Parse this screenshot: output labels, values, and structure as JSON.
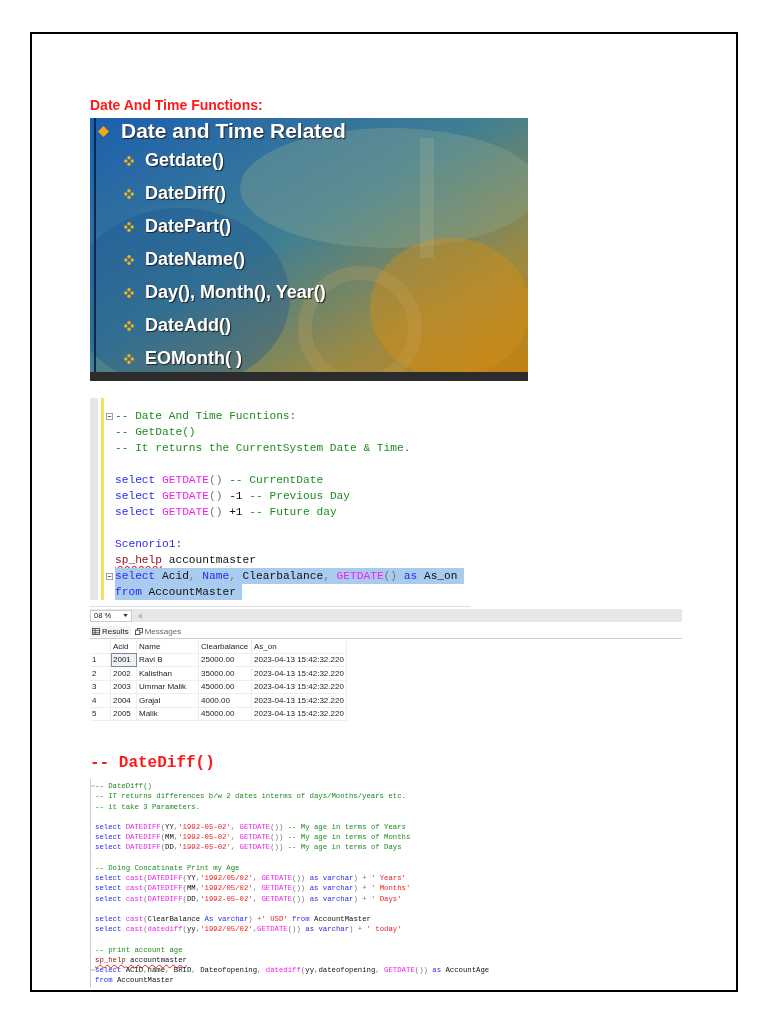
{
  "page_heading": "Date And Time Functions:",
  "slide": {
    "title": "Date and Time Related",
    "items": [
      "Getdate()",
      "DateDiff()",
      "DatePart()",
      "DateName()",
      "Day(), Month(), Year()",
      "DateAdd()",
      "EOMonth( )"
    ]
  },
  "editor": {
    "blocks": [
      [
        {
          "fold": true,
          "selected": false,
          "tokens": [
            {
              "kind": "comment",
              "text": "-- Date And Time Fucntions:"
            }
          ]
        },
        {
          "fold": false,
          "selected": false,
          "tokens": [
            {
              "kind": "comment",
              "text": "-- GetDate()"
            }
          ]
        },
        {
          "fold": false,
          "selected": false,
          "tokens": [
            {
              "kind": "comment",
              "text": "-- It returns the CurrentSystem Date & Time."
            }
          ]
        }
      ],
      [
        {
          "fold": false,
          "selected": false,
          "tokens": [
            {
              "kind": "keyword",
              "text": "select "
            },
            {
              "kind": "function",
              "text": "GETDATE"
            },
            {
              "kind": "operator",
              "text": "() "
            },
            {
              "kind": "comment",
              "text": "-- CurrentDate"
            }
          ]
        },
        {
          "fold": false,
          "selected": false,
          "tokens": [
            {
              "kind": "keyword",
              "text": "select "
            },
            {
              "kind": "function",
              "text": "GETDATE"
            },
            {
              "kind": "operator",
              "text": "() "
            },
            {
              "kind": "plain",
              "text": "-1 "
            },
            {
              "kind": "comment",
              "text": "-- Previous Day"
            }
          ]
        },
        {
          "fold": false,
          "selected": false,
          "tokens": [
            {
              "kind": "keyword",
              "text": "select "
            },
            {
              "kind": "function",
              "text": "GETDATE"
            },
            {
              "kind": "operator",
              "text": "() "
            },
            {
              "kind": "plain",
              "text": "+1 "
            },
            {
              "kind": "comment",
              "text": "-- Future day"
            }
          ]
        }
      ],
      [
        {
          "fold": false,
          "selected": false,
          "tokens": [
            {
              "kind": "keyword",
              "text": "Scenorio1:"
            }
          ]
        },
        {
          "fold": false,
          "selected": false,
          "tokens": [
            {
              "kind": "procedure",
              "text": "sp_help"
            },
            {
              "kind": "plain",
              "text": " accountmaster"
            }
          ]
        },
        {
          "fold": true,
          "selected": true,
          "tokens": [
            {
              "kind": "keyword",
              "text": "select "
            },
            {
              "kind": "plain",
              "text": "Acid"
            },
            {
              "kind": "operator",
              "text": ", "
            },
            {
              "kind": "keyword",
              "text": "Name"
            },
            {
              "kind": "operator",
              "text": ", "
            },
            {
              "kind": "plain",
              "text": "Clearbalance"
            },
            {
              "kind": "operator",
              "text": ", "
            },
            {
              "kind": "function",
              "text": "GETDATE"
            },
            {
              "kind": "operator",
              "text": "() "
            },
            {
              "kind": "keyword",
              "text": "as "
            },
            {
              "kind": "plain",
              "text": "As_on"
            }
          ]
        },
        {
          "fold": false,
          "selected": true,
          "tokens": [
            {
              "kind": "keyword",
              "text": "from "
            },
            {
              "kind": "plain",
              "text": "AccountMaster"
            }
          ]
        }
      ]
    ]
  },
  "results": {
    "zoom": "08 %",
    "tabs": [
      {
        "kind": "grid",
        "label": "Results",
        "selected": true
      },
      {
        "kind": "messages",
        "label": "Messages",
        "selected": false
      }
    ],
    "columns": [
      "Acid",
      "Name",
      "Clearbalance",
      "As_on"
    ],
    "rows": [
      {
        "number": "1",
        "cells": [
          {
            "text": "2001",
            "selected": true
          },
          {
            "text": "Ravi B",
            "selected": false
          },
          {
            "text": "25000.00",
            "selected": false
          },
          {
            "text": "2023-04-13 15:42:32.220",
            "selected": false
          }
        ]
      },
      {
        "number": "2",
        "cells": [
          {
            "text": "2002",
            "selected": false
          },
          {
            "text": "Kalisthan",
            "selected": false
          },
          {
            "text": "35000.00",
            "selected": false
          },
          {
            "text": "2023-04-13 15:42:32.220",
            "selected": false
          }
        ]
      },
      {
        "number": "3",
        "cells": [
          {
            "text": "2003",
            "selected": false
          },
          {
            "text": "Ummar Malik",
            "selected": false
          },
          {
            "text": "45000.00",
            "selected": false
          },
          {
            "text": "2023-04-13 15:42:32.220",
            "selected": false
          }
        ]
      },
      {
        "number": "4",
        "cells": [
          {
            "text": "2004",
            "selected": false
          },
          {
            "text": "Grajal",
            "selected": false
          },
          {
            "text": "4000.00",
            "selected": false
          },
          {
            "text": "2023-04-13 15:42:32.220",
            "selected": false
          }
        ]
      },
      {
        "number": "5",
        "cells": [
          {
            "text": "2005",
            "selected": false
          },
          {
            "text": "Malik",
            "selected": false
          },
          {
            "text": "45000.00",
            "selected": false
          },
          {
            "text": "2023-04-13 15:42:32.220",
            "selected": false
          }
        ]
      }
    ]
  },
  "section_heading": "-- DateDiff()",
  "editor_2": {
    "blocks": [
      [
        {
          "fold": true,
          "tokens": [
            {
              "kind": "comment",
              "text": "-- DateDiff()"
            }
          ]
        },
        {
          "fold": false,
          "tokens": [
            {
              "kind": "comment",
              "text": "-- IT returns differences b/w 2 dates interms of days/Months/years etc."
            }
          ]
        },
        {
          "fold": false,
          "tokens": [
            {
              "kind": "comment",
              "text": "-- it take 3 Parameters."
            }
          ]
        }
      ],
      [
        {
          "fold": false,
          "tokens": [
            {
              "kind": "keyword",
              "text": "select "
            },
            {
              "kind": "function",
              "text": "DATEDIFF"
            },
            {
              "kind": "operator",
              "text": "("
            },
            {
              "kind": "plain",
              "text": "YY"
            },
            {
              "kind": "operator",
              "text": ","
            },
            {
              "kind": "string",
              "text": "'1992-05-02'"
            },
            {
              "kind": "operator",
              "text": ", "
            },
            {
              "kind": "function",
              "text": "GETDATE"
            },
            {
              "kind": "operator",
              "text": "()) "
            },
            {
              "kind": "comment",
              "text": "-- My age in terms of Years"
            }
          ]
        },
        {
          "fold": false,
          "tokens": [
            {
              "kind": "keyword",
              "text": "select "
            },
            {
              "kind": "function",
              "text": "DATEDIFF"
            },
            {
              "kind": "operator",
              "text": "("
            },
            {
              "kind": "plain",
              "text": "MM"
            },
            {
              "kind": "operator",
              "text": ","
            },
            {
              "kind": "string",
              "text": "'1992-05-02'"
            },
            {
              "kind": "operator",
              "text": ", "
            },
            {
              "kind": "function",
              "text": "GETDATE"
            },
            {
              "kind": "operator",
              "text": "()) "
            },
            {
              "kind": "comment",
              "text": "-- My age in terms of Months"
            }
          ]
        },
        {
          "fold": false,
          "tokens": [
            {
              "kind": "keyword",
              "text": "select "
            },
            {
              "kind": "function",
              "text": "DATEDIFF"
            },
            {
              "kind": "operator",
              "text": "("
            },
            {
              "kind": "plain",
              "text": "DD"
            },
            {
              "kind": "operator",
              "text": ","
            },
            {
              "kind": "string",
              "text": "'1992-05-02'"
            },
            {
              "kind": "operator",
              "text": ", "
            },
            {
              "kind": "function",
              "text": "GETDATE"
            },
            {
              "kind": "operator",
              "text": "()) "
            },
            {
              "kind": "comment",
              "text": "-- My age in terms of Days"
            }
          ]
        }
      ],
      [
        {
          "fold": false,
          "tokens": [
            {
              "kind": "comment",
              "text": "-- Doing Concatinate Print my Age"
            }
          ]
        },
        {
          "fold": false,
          "tokens": [
            {
              "kind": "keyword",
              "text": "select "
            },
            {
              "kind": "function",
              "text": "cast"
            },
            {
              "kind": "operator",
              "text": "("
            },
            {
              "kind": "function",
              "text": "DATEDIFF"
            },
            {
              "kind": "operator",
              "text": "("
            },
            {
              "kind": "plain",
              "text": "YY"
            },
            {
              "kind": "operator",
              "text": ","
            },
            {
              "kind": "string",
              "text": "'1992/05/02'"
            },
            {
              "kind": "operator",
              "text": ", "
            },
            {
              "kind": "function",
              "text": "GETDATE"
            },
            {
              "kind": "operator",
              "text": "()) "
            },
            {
              "kind": "keyword",
              "text": "as varchar"
            },
            {
              "kind": "operator",
              "text": ") + "
            },
            {
              "kind": "string",
              "text": "' Years'"
            }
          ]
        },
        {
          "fold": false,
          "tokens": [
            {
              "kind": "keyword",
              "text": "select "
            },
            {
              "kind": "function",
              "text": "cast"
            },
            {
              "kind": "operator",
              "text": "("
            },
            {
              "kind": "function",
              "text": "DATEDIFF"
            },
            {
              "kind": "operator",
              "text": "("
            },
            {
              "kind": "plain",
              "text": "MM"
            },
            {
              "kind": "operator",
              "text": ","
            },
            {
              "kind": "string",
              "text": "'1992/05/02'"
            },
            {
              "kind": "operator",
              "text": ", "
            },
            {
              "kind": "function",
              "text": "GETDATE"
            },
            {
              "kind": "operator",
              "text": "()) "
            },
            {
              "kind": "keyword",
              "text": "as varchar"
            },
            {
              "kind": "operator",
              "text": ") + "
            },
            {
              "kind": "string",
              "text": "' Months'"
            }
          ]
        },
        {
          "fold": false,
          "tokens": [
            {
              "kind": "keyword",
              "text": "select "
            },
            {
              "kind": "function",
              "text": "cast"
            },
            {
              "kind": "operator",
              "text": "("
            },
            {
              "kind": "function",
              "text": "DATEDIFF"
            },
            {
              "kind": "operator",
              "text": "("
            },
            {
              "kind": "plain",
              "text": "DD"
            },
            {
              "kind": "operator",
              "text": ","
            },
            {
              "kind": "string",
              "text": "'1992-05-02'"
            },
            {
              "kind": "operator",
              "text": ", "
            },
            {
              "kind": "function",
              "text": "GETDATE"
            },
            {
              "kind": "operator",
              "text": "()) "
            },
            {
              "kind": "keyword",
              "text": "as varchar"
            },
            {
              "kind": "operator",
              "text": ") + "
            },
            {
              "kind": "string",
              "text": "' Days'"
            }
          ]
        }
      ],
      [
        {
          "fold": false,
          "tokens": [
            {
              "kind": "keyword",
              "text": "select "
            },
            {
              "kind": "function",
              "text": "cast"
            },
            {
              "kind": "operator",
              "text": "("
            },
            {
              "kind": "plain",
              "text": "ClearBalance "
            },
            {
              "kind": "keyword",
              "text": "As varchar"
            },
            {
              "kind": "operator",
              "text": ") +"
            },
            {
              "kind": "string",
              "text": "' USD'"
            },
            {
              "kind": "keyword",
              "text": " from "
            },
            {
              "kind": "plain",
              "text": "AccountMaster"
            }
          ]
        },
        {
          "fold": false,
          "tokens": [
            {
              "kind": "keyword",
              "text": "select "
            },
            {
              "kind": "function",
              "text": "cast"
            },
            {
              "kind": "operator",
              "text": "("
            },
            {
              "kind": "function",
              "text": "datediff"
            },
            {
              "kind": "operator",
              "text": "("
            },
            {
              "kind": "plain",
              "text": "yy"
            },
            {
              "kind": "operator",
              "text": ","
            },
            {
              "kind": "string",
              "text": "'1992/05/02'"
            },
            {
              "kind": "operator",
              "text": ","
            },
            {
              "kind": "function",
              "text": "GETDATE"
            },
            {
              "kind": "operator",
              "text": "()) "
            },
            {
              "kind": "keyword",
              "text": "as varchar"
            },
            {
              "kind": "operator",
              "text": ") + "
            },
            {
              "kind": "string",
              "text": "' today'"
            }
          ]
        }
      ],
      [
        {
          "fold": false,
          "tokens": [
            {
              "kind": "comment",
              "text": "-- print account age"
            }
          ]
        },
        {
          "fold": false,
          "tokens": [
            {
              "kind": "procedure",
              "text": "sp_help"
            },
            {
              "kind": "misspelled",
              "text": " accountmaster"
            }
          ]
        },
        {
          "fold": true,
          "tokens": [
            {
              "kind": "keyword",
              "text": "select "
            },
            {
              "kind": "plain",
              "text": "ACID"
            },
            {
              "kind": "operator",
              "text": ","
            },
            {
              "kind": "plain",
              "text": "name"
            },
            {
              "kind": "operator",
              "text": ", "
            },
            {
              "kind": "plain",
              "text": "BRID"
            },
            {
              "kind": "operator",
              "text": ", "
            },
            {
              "kind": "plain",
              "text": "Dateofopening"
            },
            {
              "kind": "operator",
              "text": ", "
            },
            {
              "kind": "function",
              "text": "datediff"
            },
            {
              "kind": "operator",
              "text": "("
            },
            {
              "kind": "plain",
              "text": "yy"
            },
            {
              "kind": "operator",
              "text": ","
            },
            {
              "kind": "plain",
              "text": "dateofopening"
            },
            {
              "kind": "operator",
              "text": ", "
            },
            {
              "kind": "function",
              "text": "GETDATE"
            },
            {
              "kind": "operator",
              "text": "()) "
            },
            {
              "kind": "keyword",
              "text": "as "
            },
            {
              "kind": "plain",
              "text": "AccountAge"
            }
          ]
        },
        {
          "fold": false,
          "tokens": [
            {
              "kind": "keyword",
              "text": "from "
            },
            {
              "kind": "plain",
              "text": "AccountMaster"
            }
          ]
        }
      ]
    ]
  }
}
